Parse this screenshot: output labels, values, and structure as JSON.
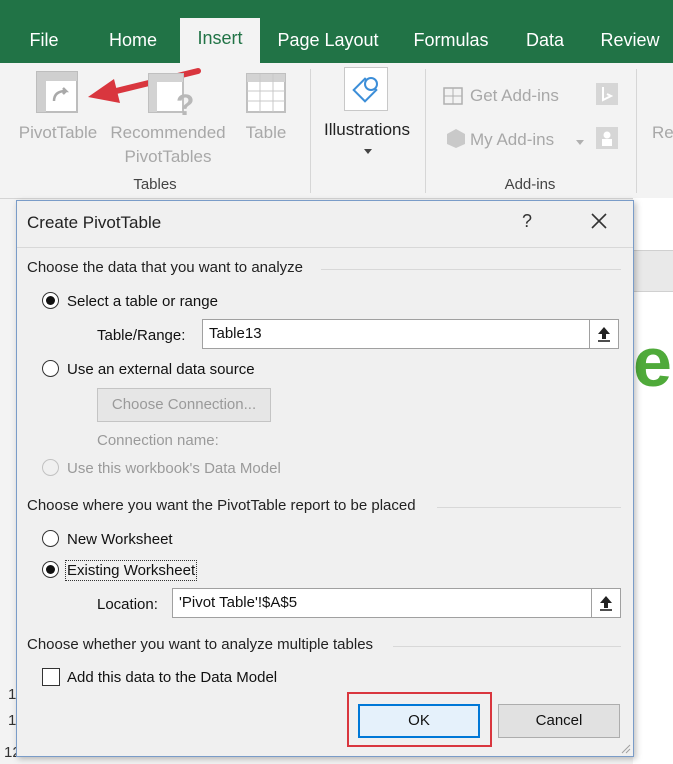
{
  "ribbon": {
    "tabs": [
      "File",
      "Home",
      "Insert",
      "Page Layout",
      "Formulas",
      "Data",
      "Review"
    ],
    "active_tab": "Insert",
    "tables_group": {
      "pivot_table": "PivotTable",
      "recommended_line1": "Recommended",
      "recommended_line2": "PivotTables",
      "table": "Table",
      "label": "Tables"
    },
    "illustrations": "Illustrations",
    "addins_group": {
      "get_addins": "Get Add-ins",
      "my_addins": "My Add-ins",
      "label": "Add-ins"
    },
    "partial_next": "Re"
  },
  "sheet": {
    "partial_letter": "e",
    "row_numbers": [
      "1",
      "1",
      "12"
    ]
  },
  "dialog": {
    "title": "Create PivotTable",
    "help": "?",
    "section1": "Choose the data that you want to analyze",
    "select_table": "Select a table or range",
    "table_range_label": "Table/Range:",
    "table_range_value": "Table13",
    "external_source": "Use an external data source",
    "choose_connection": "Choose Connection...",
    "connection_name": "Connection name:",
    "data_model": "Use this workbook's Data Model",
    "section2": "Choose where you want the PivotTable report to be placed",
    "new_worksheet": "New Worksheet",
    "existing_worksheet": "Existing Worksheet",
    "location_label": "Location:",
    "location_value": "'Pivot Table'!$A$5",
    "section3": "Choose whether you want to analyze multiple tables",
    "add_data_model": "Add this data to the Data Model",
    "ok": "OK",
    "cancel": "Cancel"
  },
  "colors": {
    "ribbon_green": "#217346",
    "annotation_red": "#d9363e",
    "focus_blue": "#0078d7"
  }
}
